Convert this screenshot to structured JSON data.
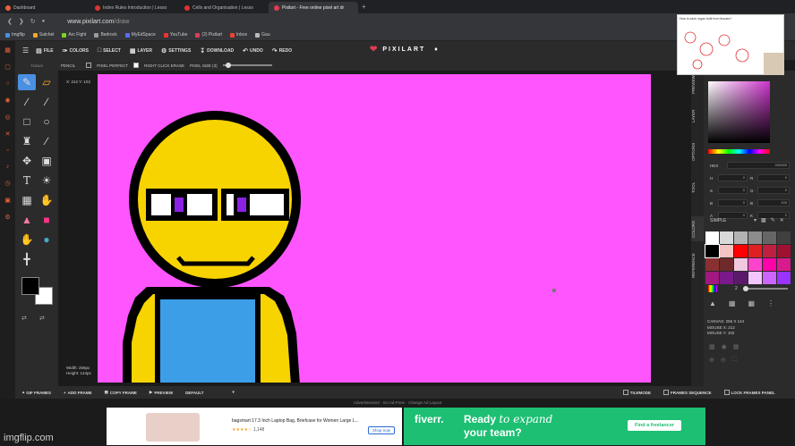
{
  "browser": {
    "tabs": [
      {
        "label": "Dashboard",
        "color": "#e8623a",
        "active": false
      },
      {
        "label": "Index Rules Introduction | Lesso",
        "color": "#d33",
        "active": false
      },
      {
        "label": "Cells and Organisation | Lesso",
        "color": "#d33",
        "active": false
      },
      {
        "label": "Pixilart - Free online pixel art dr",
        "color": "#e33b55",
        "active": true
      }
    ],
    "url_domain": "www.pixilart.com",
    "url_path": "/draw",
    "bookmarks": [
      "Imgflip",
      "Satchel",
      "Arc Fight",
      "Bedrock",
      "MyEdSpace",
      "YouTube",
      "(2) Pixilart",
      "Inbox",
      "Gau"
    ]
  },
  "menu": {
    "items": [
      "FILE",
      "COLORS",
      "SELECT",
      "LAYER",
      "SETTINGS",
      "DOWNLOAD",
      "UNDO",
      "REDO"
    ],
    "logo": "PIXILART"
  },
  "options": {
    "label": "PENCIL",
    "pixel_perfect": "PIXEL PERFECT",
    "right_click_erase": "RIGHT CLICK ERASE",
    "pixel_size": "PIXEL SIZE (3)",
    "pixel_perfect_on": false,
    "right_click_erase_on": true
  },
  "tools": {
    "title": "TOOLS",
    "primary_color": "#000000",
    "secondary_color": "#ffffff"
  },
  "canvas": {
    "coords": "X: 212 Y: 102",
    "width_label": "Width: 256px",
    "height_label": "Height: 144px",
    "background": "#ff55ff"
  },
  "sidetabs": [
    "PREVIEW",
    "LAYER",
    "OPTIONS",
    "TOOL",
    "COLORS",
    "REFERENCE"
  ],
  "colorpanel": {
    "hex_label": "HEX",
    "hex_value": "000000",
    "h": "0",
    "s": "0",
    "r": "0",
    "g": "0",
    "b": "0",
    "b2": "100",
    "a": "0",
    "k": "0",
    "palette_name": "SIMPLE",
    "brush_size": "2",
    "palette": [
      "#ffffff",
      "#d9d9d9",
      "#b3b3b3",
      "#8c8c8c",
      "#666666",
      "#404040",
      "#000000",
      "#f6c3c3",
      "#ff0000",
      "#e02020",
      "#c02040",
      "#a01030",
      "#8a3030",
      "#6e2a2a",
      "#f0c8e0",
      "#ff44cc",
      "#ff00aa",
      "#d81b8c",
      "#a01880",
      "#7a1a8a",
      "#5a1a6a",
      "#f3c6ff",
      "#cc66ff",
      "#9933ff"
    ]
  },
  "canvasinfo": {
    "canvas": "CANVAS: 256 X 144",
    "mouse_x": "MOUSE X: 212",
    "mouse_y": "MOUSE Y: 102"
  },
  "bottombar": {
    "items": [
      "GIF FRAMES",
      "ADD FRAME",
      "COPY FRAME",
      "PREVIEW",
      "DEFAULT"
    ],
    "tilemode": "TILEMODE",
    "frames_sequence": "FRAMES SEQUENCE",
    "lock_frames": "LOCK FRAMES PANEL"
  },
  "ads": {
    "line": "Advertisement · Go Ad-Free! · Change Ad Layout",
    "ad1_title": "bagsmart 17.3 Inch Laptop Bag, Briefcase for Women Large L...",
    "ad1_rating": "1,148",
    "ad1_button": "Shop now",
    "ad2_brand": "fiverr.",
    "ad2_text1": "Ready ",
    "ad2_text1b": "to expand",
    "ad2_text2": "your team?",
    "ad2_button": "Find a freelancer"
  },
  "watermark": "imgflip.com",
  "overlay_text": "How is each organ built from tissues?"
}
